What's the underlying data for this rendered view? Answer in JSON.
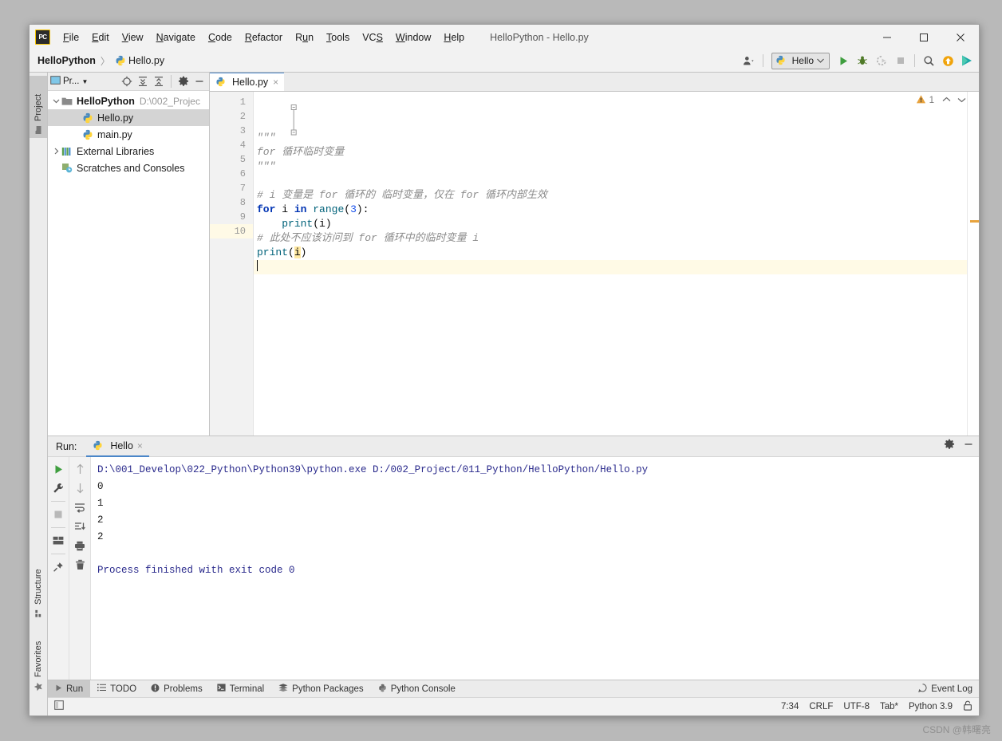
{
  "window": {
    "title": "HelloPython - Hello.py",
    "logo": "pycharm-logo",
    "controls": {
      "minimize": "minimize-icon",
      "maximize": "maximize-icon",
      "close": "close-icon"
    }
  },
  "menubar": {
    "items": [
      {
        "label": "File",
        "mnemonic": "F"
      },
      {
        "label": "Edit",
        "mnemonic": "E"
      },
      {
        "label": "View",
        "mnemonic": "V"
      },
      {
        "label": "Navigate",
        "mnemonic": "N"
      },
      {
        "label": "Code",
        "mnemonic": "C"
      },
      {
        "label": "Refactor",
        "mnemonic": "R"
      },
      {
        "label": "Run",
        "mnemonic": "u"
      },
      {
        "label": "Tools",
        "mnemonic": "T"
      },
      {
        "label": "VCS",
        "mnemonic": "S"
      },
      {
        "label": "Window",
        "mnemonic": "W"
      },
      {
        "label": "Help",
        "mnemonic": "H"
      }
    ]
  },
  "navbar": {
    "breadcrumb": {
      "root": "HelloPython",
      "separator": "〉",
      "file": "Hello.py"
    },
    "run_config": {
      "name": "Hello",
      "icon": "python-file-icon",
      "chevron": "⌄"
    },
    "actions": [
      {
        "name": "run-button",
        "icon": "play-icon",
        "color": "#3f9e3f"
      },
      {
        "name": "debug-button",
        "icon": "bug-icon",
        "color": "#4f7a28"
      },
      {
        "name": "run-coverage-button",
        "icon": "coverage-icon",
        "color": "#b0b0b0"
      },
      {
        "name": "stop-button",
        "icon": "stop-icon",
        "color": "#b0b0b0"
      },
      {
        "name": "search-everywhere-button",
        "icon": "search-icon",
        "color": "#555555"
      },
      {
        "name": "update-project-button",
        "icon": "up-arrow-circle-icon",
        "color": "#f0a30a"
      },
      {
        "name": "ide-assistant-button",
        "icon": "play-circle-icon",
        "color": "#2aa8a8"
      }
    ],
    "account_icon": "user-account-icon"
  },
  "left_tool_tabs": [
    {
      "label": "Project",
      "icon": "project-folder-icon",
      "active": true
    },
    {
      "label": "Structure",
      "icon": "structure-icon",
      "active": false
    },
    {
      "label": "Favorites",
      "icon": "star-icon",
      "active": false
    }
  ],
  "project_panel": {
    "title": "Pr...",
    "title_icon": "project-view-icon",
    "toolbar": [
      {
        "name": "select-opened-file-button",
        "icon": "target-icon"
      },
      {
        "name": "expand-all-button",
        "icon": "expand-all-icon"
      },
      {
        "name": "collapse-all-button",
        "icon": "collapse-all-icon"
      },
      {
        "name": "settings-button",
        "icon": "gear-icon"
      },
      {
        "name": "hide-button",
        "icon": "minimize-icon"
      }
    ],
    "tree": [
      {
        "label": "HelloPython",
        "path": "D:\\002_Projec",
        "icon": "folder-icon",
        "arrow": "expanded",
        "bold": true,
        "indent": 0,
        "selected": false
      },
      {
        "label": "Hello.py",
        "path": "",
        "icon": "python-file-icon",
        "arrow": "none",
        "bold": false,
        "indent": 1,
        "selected": true
      },
      {
        "label": "main.py",
        "path": "",
        "icon": "python-file-icon",
        "arrow": "none",
        "bold": false,
        "indent": 1,
        "selected": false
      },
      {
        "label": "External Libraries",
        "path": "",
        "icon": "libraries-icon",
        "arrow": "collapsed",
        "bold": false,
        "indent": 0,
        "selected": false
      },
      {
        "label": "Scratches and Consoles",
        "path": "",
        "icon": "scratches-icon",
        "arrow": "none",
        "bold": false,
        "indent": 0,
        "selected": false
      }
    ]
  },
  "editor": {
    "tab": {
      "label": "Hello.py",
      "icon": "python-file-icon",
      "close": "×"
    },
    "inspection": {
      "warning_icon": "warning-triangle-icon",
      "warning_count": "1",
      "up": "⌃",
      "down": "⌄"
    },
    "gutter_lines": [
      "1",
      "2",
      "3",
      "4",
      "5",
      "6",
      "7",
      "8",
      "9",
      "10"
    ],
    "cursor_line": 10,
    "code_lines": [
      {
        "n": 1,
        "tokens": [
          {
            "t": "\"\"\"",
            "c": "str"
          }
        ]
      },
      {
        "n": 2,
        "tokens": [
          {
            "t": "for 循环临时变量",
            "c": "str"
          }
        ]
      },
      {
        "n": 3,
        "tokens": [
          {
            "t": "\"\"\"",
            "c": "str"
          }
        ]
      },
      {
        "n": 4,
        "tokens": [
          {
            "t": "",
            "c": "pl"
          }
        ]
      },
      {
        "n": 5,
        "tokens": [
          {
            "t": "# i 变量是 for 循环的 临时变量，仅在 for 循环内部生效",
            "c": "cmt"
          }
        ]
      },
      {
        "n": 6,
        "tokens": [
          {
            "t": "for",
            "c": "kw"
          },
          {
            "t": " i ",
            "c": "pl"
          },
          {
            "t": "in",
            "c": "kw"
          },
          {
            "t": " ",
            "c": "pl"
          },
          {
            "t": "range",
            "c": "fn"
          },
          {
            "t": "(",
            "c": "pl"
          },
          {
            "t": "3",
            "c": "num"
          },
          {
            "t": "):",
            "c": "pl"
          }
        ]
      },
      {
        "n": 7,
        "tokens": [
          {
            "t": "    ",
            "c": "pl"
          },
          {
            "t": "print",
            "c": "fn"
          },
          {
            "t": "(i)",
            "c": "pl"
          }
        ]
      },
      {
        "n": 8,
        "tokens": [
          {
            "t": "# 此处不应该访问到 for 循环中的临时变量 i",
            "c": "cmt"
          }
        ]
      },
      {
        "n": 9,
        "tokens": [
          {
            "t": "print",
            "c": "fn"
          },
          {
            "t": "(",
            "c": "pl"
          },
          {
            "t": "i",
            "c": "hl-i"
          },
          {
            "t": ")",
            "c": "pl"
          }
        ]
      },
      {
        "n": 10,
        "tokens": [
          {
            "t": "",
            "c": "pl"
          }
        ]
      }
    ]
  },
  "run_panel": {
    "label": "Run:",
    "tab": {
      "label": "Hello",
      "icon": "python-file-icon",
      "close": "×"
    },
    "header_actions": [
      {
        "name": "settings-button",
        "icon": "gear-icon"
      },
      {
        "name": "hide-button",
        "icon": "minimize-icon"
      }
    ],
    "tools_col1": [
      {
        "name": "rerun-button",
        "icon": "play-icon",
        "color": "#3f9e3f"
      },
      {
        "name": "edit-configurations-button",
        "icon": "wrench-icon",
        "color": "#4a4a4a"
      },
      {
        "name": "stop-button",
        "icon": "stop-icon",
        "color": "#b0b0b0"
      },
      {
        "name": "layout-button",
        "icon": "layout-icon",
        "color": "#5a5a5a"
      },
      {
        "name": "pin-tab-button",
        "icon": "pin-icon",
        "color": "#5a5a5a"
      }
    ],
    "tools_col2": [
      {
        "name": "up-button",
        "icon": "arrow-up-icon",
        "color": "#a0a0a0"
      },
      {
        "name": "down-button",
        "icon": "arrow-down-icon",
        "color": "#a0a0a0"
      },
      {
        "name": "soft-wrap-button",
        "icon": "soft-wrap-icon",
        "color": "#5a5a5a"
      },
      {
        "name": "scroll-to-end-button",
        "icon": "scroll-end-icon",
        "color": "#5a5a5a"
      },
      {
        "name": "print-button",
        "icon": "printer-icon",
        "color": "#5a5a5a"
      },
      {
        "name": "clear-all-button",
        "icon": "trash-icon",
        "color": "#5a5a5a"
      }
    ],
    "console": [
      {
        "text": "D:\\001_Develop\\022_Python\\Python39\\python.exe D:/002_Project/011_Python/HelloPython/Hello.py",
        "kind": "cmd"
      },
      {
        "text": "0",
        "kind": "out"
      },
      {
        "text": "1",
        "kind": "out"
      },
      {
        "text": "2",
        "kind": "out"
      },
      {
        "text": "2",
        "kind": "out"
      },
      {
        "text": "",
        "kind": "out"
      },
      {
        "text": "Process finished with exit code 0",
        "kind": "cmd"
      }
    ]
  },
  "bottom_bar": {
    "items": [
      {
        "label": "Run",
        "icon": "play-icon",
        "active": true
      },
      {
        "label": "TODO",
        "icon": "todo-list-icon",
        "active": false
      },
      {
        "label": "Problems",
        "icon": "problems-icon",
        "active": false
      },
      {
        "label": "Terminal",
        "icon": "terminal-icon",
        "active": false
      },
      {
        "label": "Python Packages",
        "icon": "packages-icon",
        "active": false
      },
      {
        "label": "Python Console",
        "icon": "python-console-icon",
        "active": false
      }
    ],
    "event_log": {
      "label": "Event Log",
      "icon": "event-log-icon"
    }
  },
  "statusbar": {
    "left_icon": "toggle-toolbar-icon",
    "items": [
      {
        "label": "7:34",
        "name": "caret-position"
      },
      {
        "label": "CRLF",
        "name": "line-separator"
      },
      {
        "label": "UTF-8",
        "name": "file-encoding"
      },
      {
        "label": "Tab*",
        "name": "indent-setting"
      },
      {
        "label": "Python 3.9",
        "name": "interpreter"
      }
    ],
    "lock_icon": "lock-icon"
  },
  "watermark": "CSDN @韩曙亮",
  "colors": {
    "accent_blue": "#4a86c8",
    "run_green": "#3f9e3f",
    "warning_orange": "#e8a33d",
    "keyword_blue": "#0033b3",
    "string_gray": "#8c8c8c",
    "console_blue": "#2a2a8c",
    "chrome_gray": "#f2f2f2"
  }
}
